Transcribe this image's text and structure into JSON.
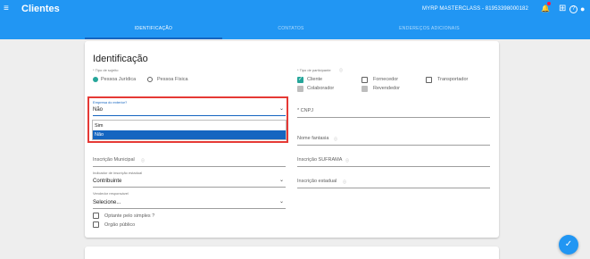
{
  "topbar": {
    "menu_icon": "≡",
    "title": "Clientes",
    "company": "MYRP MASTERCLASS - 81953398000182",
    "icons": [
      "bell-icon",
      "apps-icon",
      "help-icon",
      "account-icon"
    ],
    "glyphs": {
      "bell": "🔔",
      "apps": "⊞",
      "help": "?",
      "account": "●"
    }
  },
  "tabs": [
    {
      "label": "IDENTIFICAÇÃO",
      "active": true
    },
    {
      "label": "CONTATOS",
      "active": false
    },
    {
      "label": "ENDEREÇOS ADICIONAIS",
      "active": false
    }
  ],
  "section": {
    "title": "Identificação",
    "subject_type_label": "* Tipo de sujeito",
    "subject_options": [
      "Pessoa Jurídica",
      "Pessoa Física"
    ],
    "participation_label": "* Tipo de participante",
    "participation_options": [
      "Cliente",
      "Fornecedor",
      "Transportador",
      "Colaborador",
      "Revendedor"
    ],
    "foreign_label": "Empresa do exterior?",
    "foreign_value": "Não",
    "dropdown_options": [
      "Sim",
      "Não"
    ],
    "cnpj_label": "* CNPJ",
    "trade_name_label": "Nome fantasia",
    "municipal_label": "Inscrição Municipal",
    "suframa_label": "Inscrição SUFRAMA",
    "state_indicator_label": "Indicador de inscrição estadual",
    "state_indicator_value": "Contribuinte",
    "state_reg_label": "Inscrição estadual",
    "seller_label": "Vendedor responsável",
    "seller_value": "Selecione...",
    "simples_label": "Optante pelo simples ?",
    "public_label": "Orgão público",
    "info_glyph": "ⓘ",
    "chevron": "⌄",
    "check": "✓"
  },
  "fab": {
    "icon": "check-icon",
    "glyph": "✓"
  },
  "colors": {
    "primary": "#2196f3",
    "accent": "#26a69a",
    "highlight": "#e53935",
    "selected": "#1565c0"
  }
}
